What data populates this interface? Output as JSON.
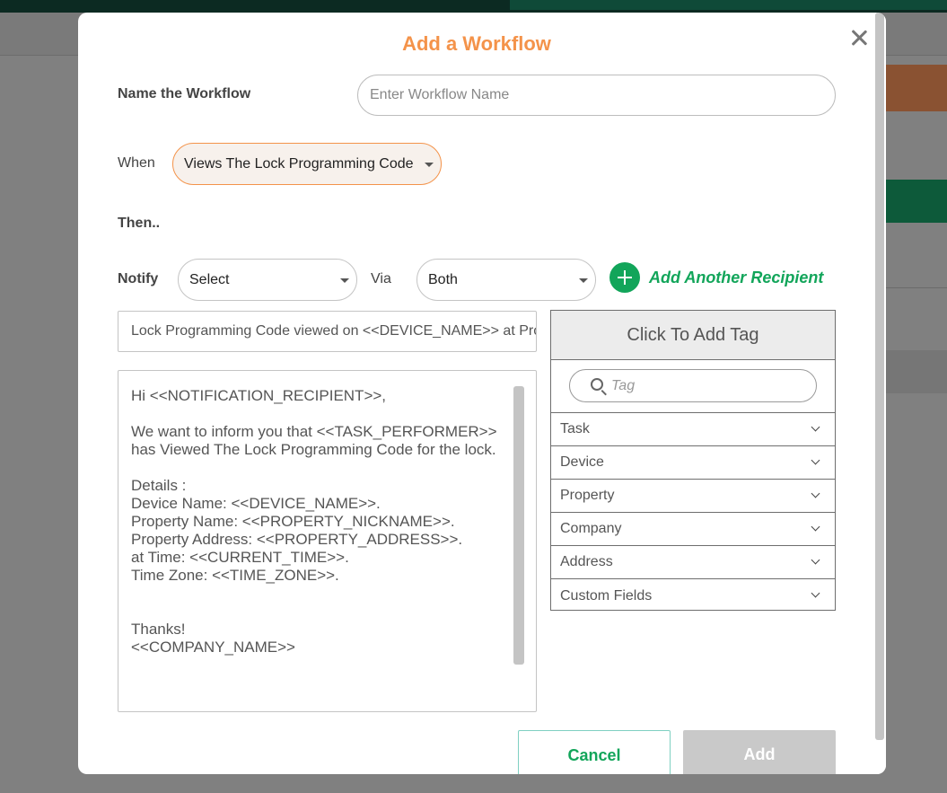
{
  "modal": {
    "title": "Add a Workflow"
  },
  "form": {
    "name_label": "Name the Workflow",
    "name_placeholder": "Enter Workflow Name",
    "when_label": "When",
    "when_value": "Views The Lock Programming Code",
    "then_label": "Then..",
    "notify_label": "Notify",
    "notify_value": "Select",
    "via_label": "Via",
    "via_value": "Both",
    "add_recipient_label": "Add Another Recipient",
    "subject_value": "Lock Programming Code viewed on <<DEVICE_NAME>> at Pro",
    "body_text": "Hi <<NOTIFICATION_RECIPIENT>>,\n\nWe want to inform you that <<TASK_PERFORMER>> has Viewed The Lock Programming Code for the lock.\n\nDetails :\nDevice Name: <<DEVICE_NAME>>.\nProperty Name: <<PROPERTY_NICKNAME>>.\nProperty Address: <<PROPERTY_ADDRESS>>.\nat Time: <<CURRENT_TIME>>.\nTime Zone: <<TIME_ZONE>>.\n\n\nThanks!\n<<COMPANY_NAME>>"
  },
  "tag_panel": {
    "header": "Click To Add Tag",
    "search_placeholder": "Tag",
    "items": [
      {
        "label": "Task"
      },
      {
        "label": "Device"
      },
      {
        "label": "Property"
      },
      {
        "label": "Company"
      },
      {
        "label": "Address"
      },
      {
        "label": "Custom Fields"
      }
    ]
  },
  "buttons": {
    "cancel": "Cancel",
    "add": "Add"
  },
  "colors": {
    "accent_orange": "#f4934a",
    "accent_green": "#12a55a",
    "disabled_grey": "#c9c9c9"
  }
}
